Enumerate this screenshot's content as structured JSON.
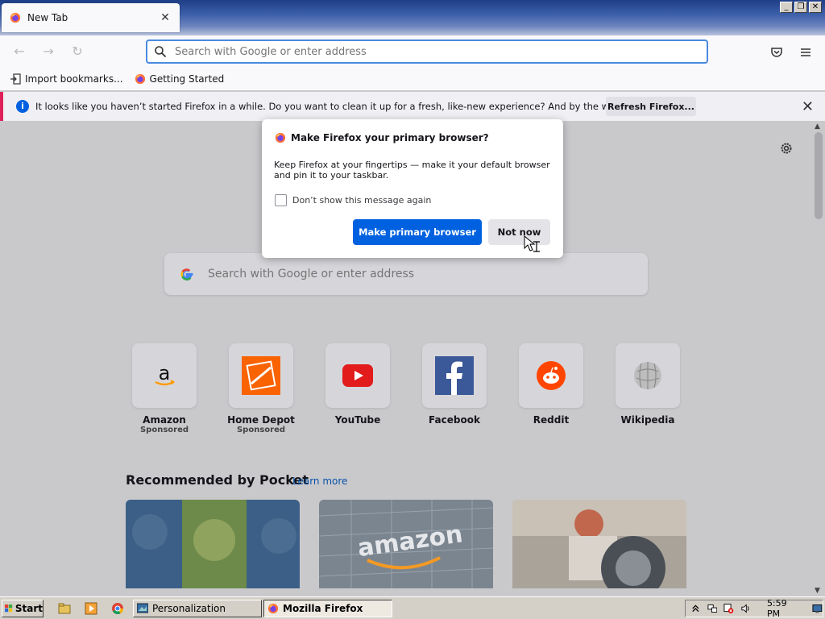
{
  "browser": {
    "tab": {
      "title": "New Tab",
      "close": "✕"
    },
    "window_controls": {
      "minimize": "_",
      "restore": "❐",
      "close": "✕"
    },
    "urlbar": {
      "placeholder": "Search with Google or enter address"
    },
    "bookmarks": [
      {
        "label": "Import bookmarks...",
        "icon": "import-icon"
      },
      {
        "label": "Getting Started",
        "icon": "firefox-icon"
      }
    ]
  },
  "notification": {
    "message": "It looks like you haven’t started Firefox in a while. Do you want to clean it up for a fresh, like-new experience? And by the way, welcome back!",
    "button": "Refresh Firefox...",
    "close": "✕"
  },
  "newtab": {
    "search_placeholder": "Search with Google or enter address",
    "top_sites": [
      {
        "name": "Amazon",
        "sponsored": "Sponsored",
        "icon": "amazon-icon"
      },
      {
        "name": "Home Depot",
        "sponsored": "Sponsored",
        "icon": "home-depot-icon"
      },
      {
        "name": "YouTube",
        "sponsored": "",
        "icon": "youtube-icon"
      },
      {
        "name": "Facebook",
        "sponsored": "",
        "icon": "facebook-icon"
      },
      {
        "name": "Reddit",
        "sponsored": "",
        "icon": "reddit-icon"
      },
      {
        "name": "Wikipedia",
        "sponsored": "",
        "icon": "wikipedia-icon"
      }
    ],
    "pocket": {
      "title": "Recommended by Pocket",
      "learn_more": "Learn more"
    }
  },
  "dialog": {
    "title": "Make Firefox your primary browser?",
    "body": "Keep Firefox at your fingertips — make it your default browser and pin it to your taskbar.",
    "checkbox_label": "Don’t show this message again",
    "primary_button": "Make primary browser",
    "secondary_button": "Not now"
  },
  "taskbar": {
    "start": "Start",
    "tasks": [
      {
        "label": "Personalization",
        "active": false
      },
      {
        "label": "Mozilla Firefox",
        "active": true
      }
    ],
    "clock": "5:59 PM"
  },
  "colors": {
    "accent": "#0061e0",
    "notification_stripe": "#e0205a"
  }
}
